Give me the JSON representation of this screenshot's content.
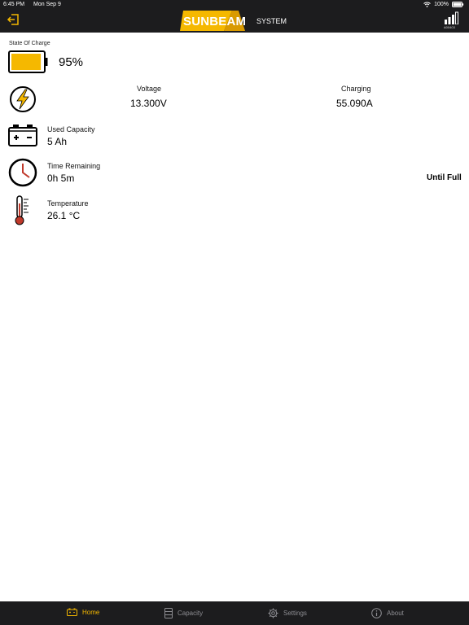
{
  "status_bar": {
    "time": "6:45 PM",
    "date": "Mon Sep 9",
    "battery_percent": "100%"
  },
  "header": {
    "logo_word": "SUNBEAM",
    "logo_suffix": "SYSTEM",
    "device_id": "A00403",
    "brand_color": "#f5b800"
  },
  "state_of_charge": {
    "label": "State Of Charge",
    "value": "95%",
    "fill_fraction": 0.95
  },
  "power": {
    "voltage_label": "Voltage",
    "voltage_value": "13.300V",
    "charging_label": "Charging",
    "charging_value": "55.090A"
  },
  "used_capacity": {
    "label": "Used Capacity",
    "value": "5 Ah"
  },
  "time_remaining": {
    "label": "Time Remaining",
    "value": "0h 5m",
    "note": "Until Full"
  },
  "temperature": {
    "label": "Temperature",
    "value": "26.1 °C"
  },
  "tabs": [
    {
      "label": "Home",
      "icon": "battery-icon",
      "active": true
    },
    {
      "label": "Capacity",
      "icon": "capacity-icon",
      "active": false
    },
    {
      "label": "Settings",
      "icon": "gear-icon",
      "active": false
    },
    {
      "label": "About",
      "icon": "info-icon",
      "active": false
    }
  ]
}
